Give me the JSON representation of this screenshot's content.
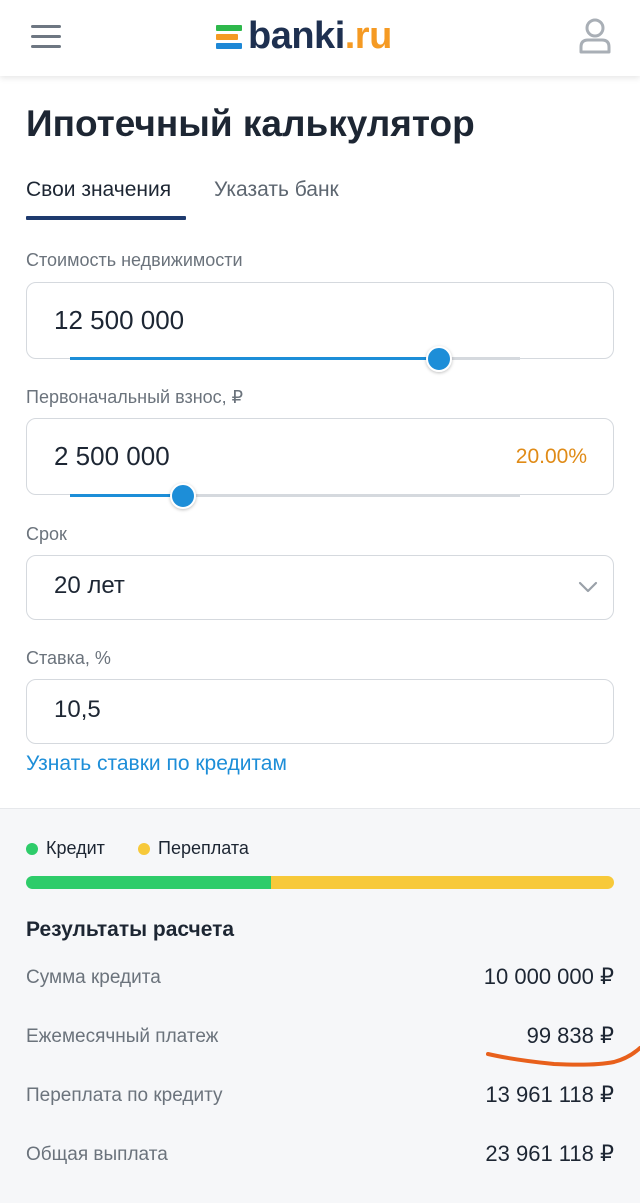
{
  "header": {
    "logo_text": "banki",
    "logo_dot_text": ".ru"
  },
  "page": {
    "title": "Ипотечный калькулятор"
  },
  "tabs": [
    {
      "label": "Свои значения",
      "active": true
    },
    {
      "label": "Указать банк",
      "active": false
    }
  ],
  "fields": {
    "property_cost": {
      "label": "Стоимость недвижимости",
      "value": "12 500 000",
      "slider_fraction": 0.82
    },
    "down_payment": {
      "label": "Первоначальный взнос, ₽",
      "value": "2 500 000",
      "percent": "20.00%",
      "slider_fraction": 0.25
    },
    "term": {
      "label": "Срок",
      "value": "20 лет"
    },
    "rate": {
      "label": "Ставка, %",
      "value": "10,5"
    }
  },
  "rates_link": "Узнать ставки по кредитам",
  "legend": {
    "credit": "Кредит",
    "overpayment": "Переплата"
  },
  "breakdown": {
    "credit_fraction": 0.417
  },
  "results": {
    "title": "Результаты расчета",
    "rows": [
      {
        "label": "Сумма кредита",
        "value": "10 000 000 ₽"
      },
      {
        "label": "Ежемесячный платеж",
        "value": "99 838 ₽"
      },
      {
        "label": "Переплата по кредиту",
        "value": "13 961 118 ₽"
      },
      {
        "label": "Общая выплата",
        "value": "23 961 118 ₽"
      }
    ]
  },
  "colors": {
    "accent": "#1d8ed8",
    "brand_dark": "#1e3a6e",
    "credit": "#2ecc6a",
    "overpayment": "#f7c93a",
    "percent": "#e08b17",
    "annotation": "#e8601c"
  },
  "icons": {
    "menu": "menu-icon",
    "user": "user-icon",
    "chevron": "chevron-down-icon"
  }
}
